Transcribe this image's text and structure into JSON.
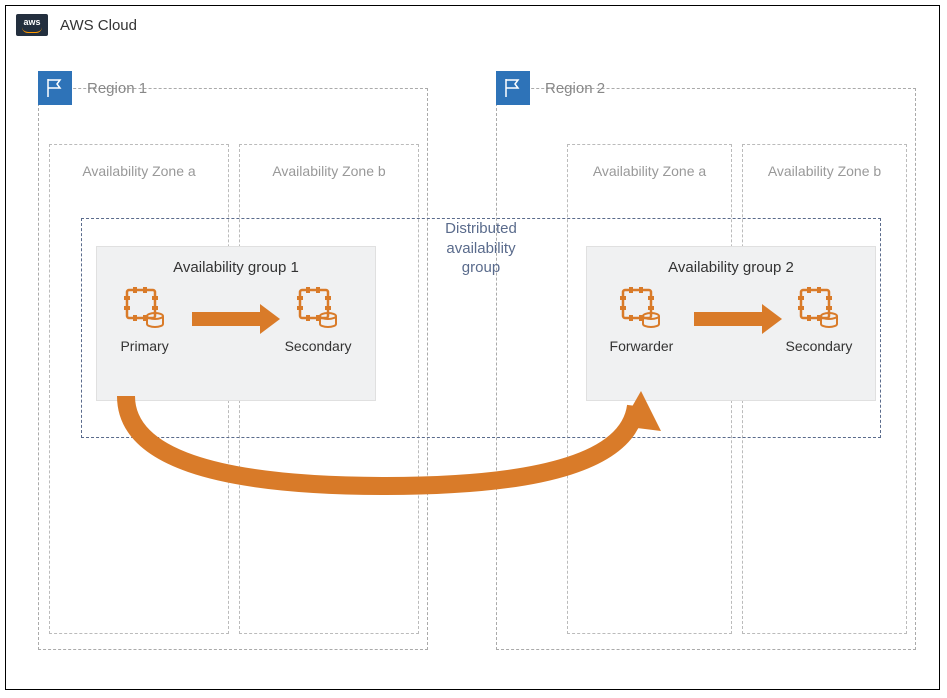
{
  "cloud": {
    "label": "AWS Cloud",
    "logo": "aws"
  },
  "regions": [
    {
      "label": "Region 1",
      "zones": [
        {
          "label": "Availability Zone a"
        },
        {
          "label": "Availability Zone b"
        }
      ]
    },
    {
      "label": "Region 2",
      "zones": [
        {
          "label": "Availability Zone a"
        },
        {
          "label": "Availability Zone b"
        }
      ]
    }
  ],
  "dag": {
    "label": "Distributed availability group"
  },
  "groups": [
    {
      "title": "Availability group 1",
      "nodes": [
        {
          "role": "Primary"
        },
        {
          "role": "Secondary"
        }
      ]
    },
    {
      "title": "Availability group 2",
      "nodes": [
        {
          "role": "Forwarder"
        },
        {
          "role": "Secondary"
        }
      ]
    }
  ],
  "connections": [
    {
      "from": "Primary",
      "to": "Secondary",
      "within": "Availability group 1",
      "type": "sync"
    },
    {
      "from": "Forwarder",
      "to": "Secondary",
      "within": "Availability group 2",
      "type": "sync"
    },
    {
      "from": "Primary",
      "to": "Forwarder",
      "via": "Distributed availability group",
      "type": "cross-region"
    }
  ],
  "colors": {
    "accent": "#d97b29",
    "region_flag": "#2e73b8",
    "dag_border": "#5a6b8c"
  }
}
